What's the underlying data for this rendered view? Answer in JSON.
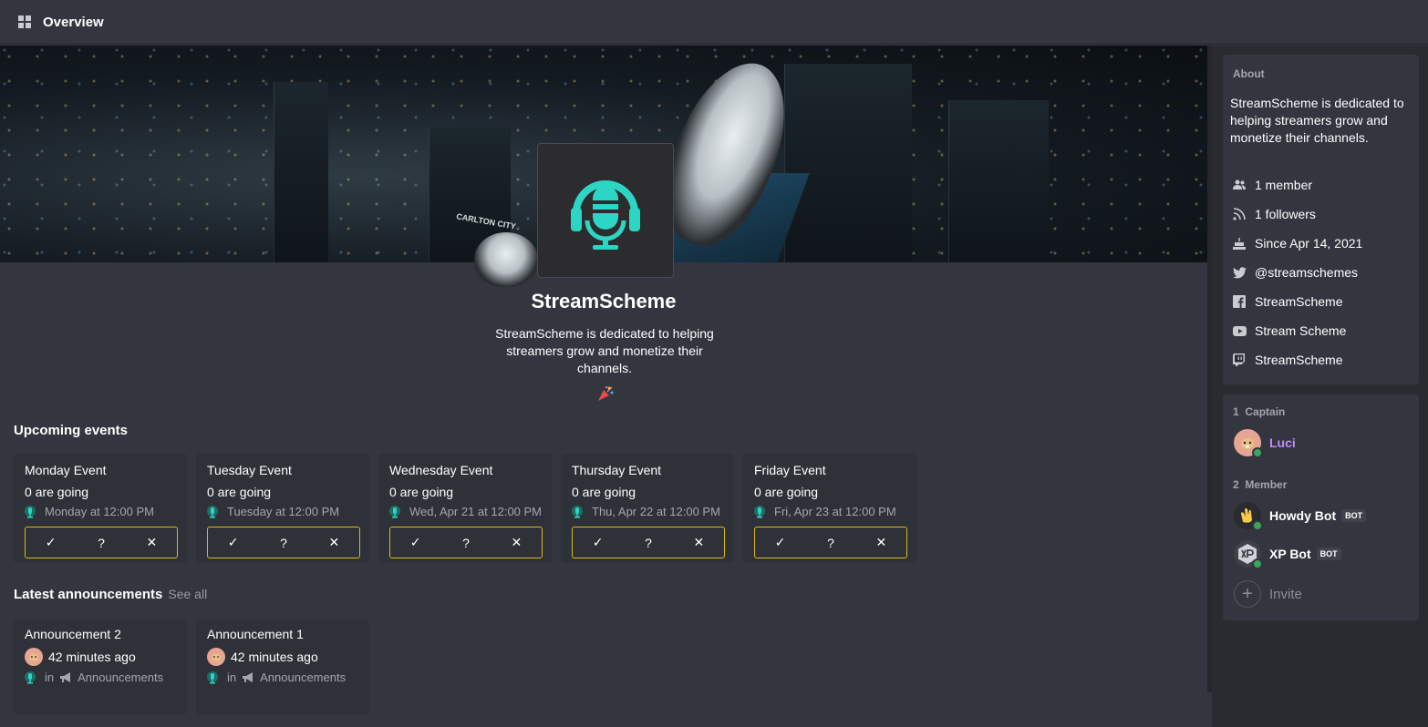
{
  "topbar": {
    "title": "Overview",
    "icon": "grid-icon"
  },
  "server": {
    "name": "StreamScheme",
    "description": "StreamScheme is dedicated to helping streamers grow and monetize their channels.",
    "accent_color": "#2cd5c4",
    "banner_sign": "CARLTON CITY"
  },
  "events": {
    "title": "Upcoming events",
    "items": [
      {
        "title": "Monday Event",
        "going": "0 are going",
        "time": "Monday at 12:00 PM"
      },
      {
        "title": "Tuesday Event",
        "going": "0 are going",
        "time": "Tuesday at 12:00 PM"
      },
      {
        "title": "Wednesday Event",
        "going": "0 are going",
        "time": "Wed, Apr 21 at 12:00 PM"
      },
      {
        "title": "Thursday Event",
        "going": "0 are going",
        "time": "Thu, Apr 22 at 12:00 PM"
      },
      {
        "title": "Friday Event",
        "going": "0 are going",
        "time": "Fri, Apr 23 at 12:00 PM"
      }
    ],
    "rsvp": {
      "yes": "✓",
      "maybe": "?",
      "no": "✕"
    },
    "rsvp_border_color": "#d9b91c"
  },
  "announcements": {
    "title": "Latest announcements",
    "see_all": "See all",
    "in_label": "in",
    "items": [
      {
        "title": "Announcement 2",
        "time": "42 minutes ago",
        "channel": "Announcements"
      },
      {
        "title": "Announcement 1",
        "time": "42 minutes ago",
        "channel": "Announcements"
      }
    ]
  },
  "about": {
    "heading": "About",
    "description": "StreamScheme is dedicated to helping streamers grow and monetize their channels.",
    "rows": [
      {
        "icon": "members-icon",
        "text": "1 member"
      },
      {
        "icon": "rss-icon",
        "text": "1 followers"
      },
      {
        "icon": "cake-icon",
        "text": "Since Apr 14, 2021"
      },
      {
        "icon": "twitter-icon",
        "text": "@streamschemes"
      },
      {
        "icon": "facebook-icon",
        "text": "StreamScheme"
      },
      {
        "icon": "youtube-icon",
        "text": "Stream Scheme"
      },
      {
        "icon": "twitch-icon",
        "text": "StreamScheme"
      }
    ]
  },
  "members": {
    "captain_heading_count": "1",
    "captain_heading": "Captain",
    "member_heading_count": "2",
    "member_heading": "Member",
    "captain": {
      "name": "Luci",
      "name_color": "#c58af9"
    },
    "list": [
      {
        "name": "Howdy Bot",
        "tag": "BOT"
      },
      {
        "name": "XP Bot",
        "tag": "BOT"
      }
    ],
    "invite_label": "Invite",
    "online_color": "#3ba55c"
  }
}
